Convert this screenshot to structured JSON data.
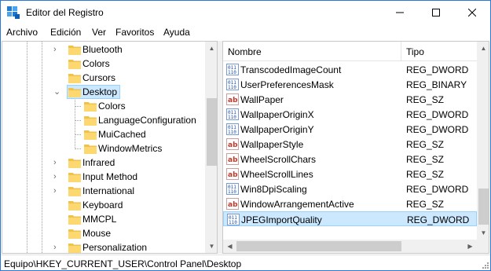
{
  "window": {
    "title": "Editor del Registro",
    "accent": "#2b79d6"
  },
  "menu": {
    "items": [
      "Archivo",
      "Edición",
      "Ver",
      "Favoritos",
      "Ayuda"
    ]
  },
  "tree": {
    "items": [
      {
        "label": "Bluetooth",
        "expandable": true,
        "level": 1
      },
      {
        "label": "Colors",
        "expandable": false,
        "level": 1
      },
      {
        "label": "Cursors",
        "expandable": false,
        "level": 1
      },
      {
        "label": "Desktop",
        "expandable": true,
        "expanded": true,
        "selected": true,
        "level": 1
      },
      {
        "label": "Colors",
        "expandable": false,
        "level": 2
      },
      {
        "label": "LanguageConfiguration",
        "expandable": false,
        "level": 2
      },
      {
        "label": "MuiCached",
        "expandable": false,
        "level": 2
      },
      {
        "label": "WindowMetrics",
        "expandable": false,
        "level": 2
      },
      {
        "label": "Infrared",
        "expandable": true,
        "level": 1
      },
      {
        "label": "Input Method",
        "expandable": true,
        "level": 1
      },
      {
        "label": "International",
        "expandable": true,
        "level": 1
      },
      {
        "label": "Keyboard",
        "expandable": false,
        "level": 1
      },
      {
        "label": "MMCPL",
        "expandable": false,
        "level": 1
      },
      {
        "label": "Mouse",
        "expandable": false,
        "level": 1
      },
      {
        "label": "Personalization",
        "expandable": true,
        "level": 1
      }
    ]
  },
  "list": {
    "columns": {
      "name": "Nombre",
      "type": "Tipo"
    },
    "rows": [
      {
        "name": "TranscodedImageCount",
        "type": "REG_DWORD",
        "icon": "binary-value-icon"
      },
      {
        "name": "UserPreferencesMask",
        "type": "REG_BINARY",
        "icon": "binary-value-icon"
      },
      {
        "name": "WallPaper",
        "type": "REG_SZ",
        "icon": "string-value-icon"
      },
      {
        "name": "WallpaperOriginX",
        "type": "REG_DWORD",
        "icon": "binary-value-icon"
      },
      {
        "name": "WallpaperOriginY",
        "type": "REG_DWORD",
        "icon": "binary-value-icon"
      },
      {
        "name": "WallpaperStyle",
        "type": "REG_SZ",
        "icon": "string-value-icon"
      },
      {
        "name": "WheelScrollChars",
        "type": "REG_SZ",
        "icon": "string-value-icon"
      },
      {
        "name": "WheelScrollLines",
        "type": "REG_SZ",
        "icon": "string-value-icon"
      },
      {
        "name": "Win8DpiScaling",
        "type": "REG_DWORD",
        "icon": "binary-value-icon"
      },
      {
        "name": "WindowArrangementActive",
        "type": "REG_SZ",
        "icon": "string-value-icon"
      },
      {
        "name": "JPEGImportQuality",
        "type": "REG_DWORD",
        "icon": "binary-value-icon",
        "selected": true
      }
    ]
  },
  "status": {
    "path": "Equipo\\HKEY_CURRENT_USER\\Control Panel\\Desktop"
  }
}
